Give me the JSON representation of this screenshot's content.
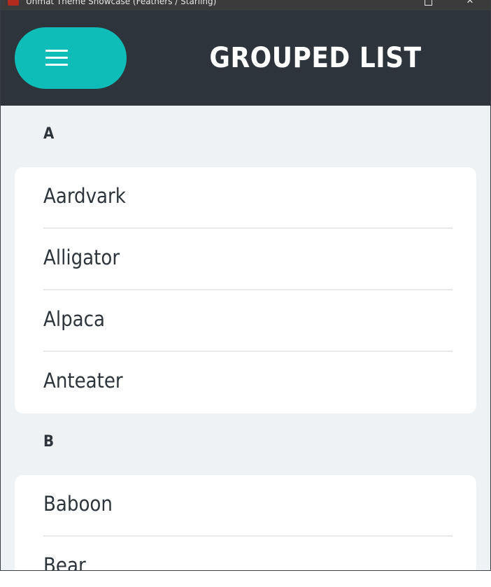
{
  "window": {
    "title": "Unmat Theme Showcase (Feathers / Starling)"
  },
  "header": {
    "title": "GROUPED LIST",
    "menu_icon": "hamburger-icon"
  },
  "colors": {
    "header_bg": "#2d343b",
    "accent": "#0ebdb7",
    "content_bg": "#eff2f4",
    "card_bg": "#ffffff",
    "text": "#2d343b"
  },
  "groups": [
    {
      "label": "A",
      "items": [
        {
          "label": "Aardvark"
        },
        {
          "label": "Alligator"
        },
        {
          "label": "Alpaca"
        },
        {
          "label": "Anteater"
        }
      ]
    },
    {
      "label": "B",
      "items": [
        {
          "label": "Baboon"
        },
        {
          "label": "Bear"
        }
      ]
    }
  ]
}
